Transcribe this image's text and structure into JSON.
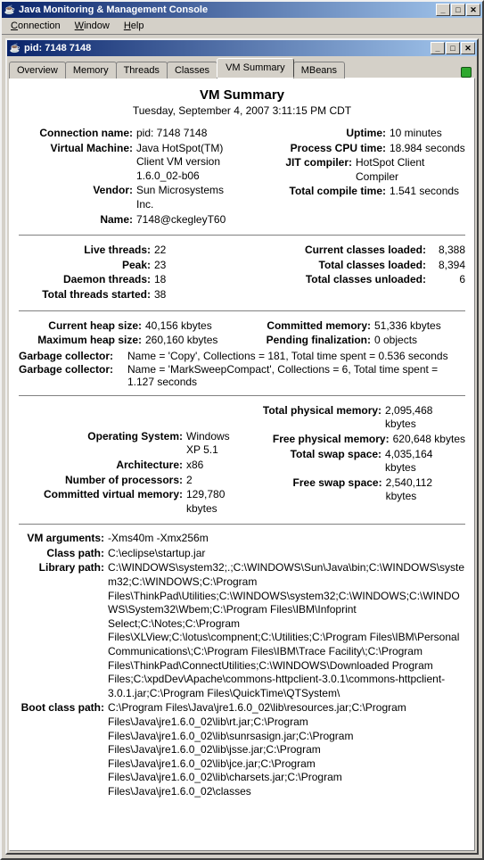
{
  "window": {
    "title": "Java Monitoring & Management Console"
  },
  "menu": {
    "connection": "Connection",
    "window": "Window",
    "help": "Help"
  },
  "child": {
    "title": "pid: 7148 7148"
  },
  "tabs": {
    "overview": "Overview",
    "memory": "Memory",
    "threads": "Threads",
    "classes": "Classes",
    "vmsummary": "VM Summary",
    "mbeans": "MBeans"
  },
  "header": {
    "title": "VM Summary",
    "date": "Tuesday, September 4, 2007 3:11:15 PM CDT"
  },
  "conn": {
    "connection_name_lab": "Connection name:",
    "connection_name": "pid: 7148 7148",
    "vm_lab": "Virtual Machine:",
    "vm": "Java HotSpot(TM) Client VM version 1.6.0_02-b06",
    "vendor_lab": "Vendor:",
    "vendor": "Sun Microsystems Inc.",
    "name_lab": "Name:",
    "name": "7148@ckegleyT60",
    "uptime_lab": "Uptime:",
    "uptime": "10 minutes",
    "cpu_lab": "Process CPU time:",
    "cpu": "18.984 seconds",
    "jit_lab": "JIT compiler:",
    "jit": "HotSpot Client Compiler",
    "compile_lab": "Total compile time:",
    "compile": "1.541 seconds"
  },
  "threads": {
    "live_lab": "Live threads:",
    "live": "22",
    "peak_lab": "Peak:",
    "peak": "23",
    "daemon_lab": "Daemon threads:",
    "daemon": "18",
    "total_lab": "Total threads started:",
    "total": "38",
    "cur_loaded_lab": "Current classes loaded:",
    "cur_loaded": "8,388",
    "tot_loaded_lab": "Total classes loaded:",
    "tot_loaded": "8,394",
    "unloaded_lab": "Total classes unloaded:",
    "unloaded": "6"
  },
  "heap": {
    "cur_lab": "Current heap size:",
    "cur": "40,156 kbytes",
    "max_lab": "Maximum heap size:",
    "max": "260,160 kbytes",
    "committed_lab": "Committed memory:",
    "committed": "51,336 kbytes",
    "pending_lab": "Pending finalization:",
    "pending": "0 objects",
    "gc_lab": "Garbage collector:",
    "gc1": "Name = 'Copy', Collections = 181, Total time spent = 0.536 seconds",
    "gc2": "Name = 'MarkSweepCompact', Collections = 6, Total time spent = 1.127 seconds"
  },
  "os": {
    "os_lab": "Operating System:",
    "os": "Windows XP 5.1",
    "arch_lab": "Architecture:",
    "arch": "x86",
    "nproc_lab": "Number of processors:",
    "nproc": "2",
    "cvm_lab": "Committed virtual memory:",
    "cvm": "129,780 kbytes",
    "tpm_lab": "Total physical memory:",
    "tpm": "2,095,468 kbytes",
    "fpm_lab": "Free physical memory:",
    "fpm": "  620,648 kbytes",
    "tss_lab": "Total swap space:",
    "tss": "4,035,164 kbytes",
    "fss_lab": "Free swap space:",
    "fss": "2,540,112 kbytes"
  },
  "paths": {
    "vmargs_lab": "VM arguments:",
    "vmargs": "-Xms40m -Xmx256m",
    "classpath_lab": "Class path:",
    "classpath": "C:\\eclipse\\startup.jar",
    "libpath_lab": "Library path:",
    "libpath": "C:\\WINDOWS\\system32;.;C:\\WINDOWS\\Sun\\Java\\bin;C:\\WINDOWS\\system32;C:\\WINDOWS;C:\\Program Files\\ThinkPad\\Utilities;C:\\WINDOWS\\system32;C:\\WINDOWS;C:\\WINDOWS\\System32\\Wbem;C:\\Program Files\\IBM\\Infoprint Select;C:\\Notes;C:\\Program Files\\XLView;C:\\lotus\\compnent;C:\\Utilities;C:\\Program Files\\IBM\\Personal Communications\\;C:\\Program Files\\IBM\\Trace Facility\\;C:\\Program Files\\ThinkPad\\ConnectUtilities;C:\\WINDOWS\\Downloaded Program Files;C:\\xpdDev\\Apache\\commons-httpclient-3.0.1\\commons-httpclient-3.0.1.jar;C:\\Program Files\\QuickTime\\QTSystem\\",
    "bootcp_lab": "Boot class path:",
    "bootcp": "C:\\Program Files\\Java\\jre1.6.0_02\\lib\\resources.jar;C:\\Program Files\\Java\\jre1.6.0_02\\lib\\rt.jar;C:\\Program Files\\Java\\jre1.6.0_02\\lib\\sunrsasign.jar;C:\\Program Files\\Java\\jre1.6.0_02\\lib\\jsse.jar;C:\\Program Files\\Java\\jre1.6.0_02\\lib\\jce.jar;C:\\Program Files\\Java\\jre1.6.0_02\\lib\\charsets.jar;C:\\Program Files\\Java\\jre1.6.0_02\\classes"
  }
}
